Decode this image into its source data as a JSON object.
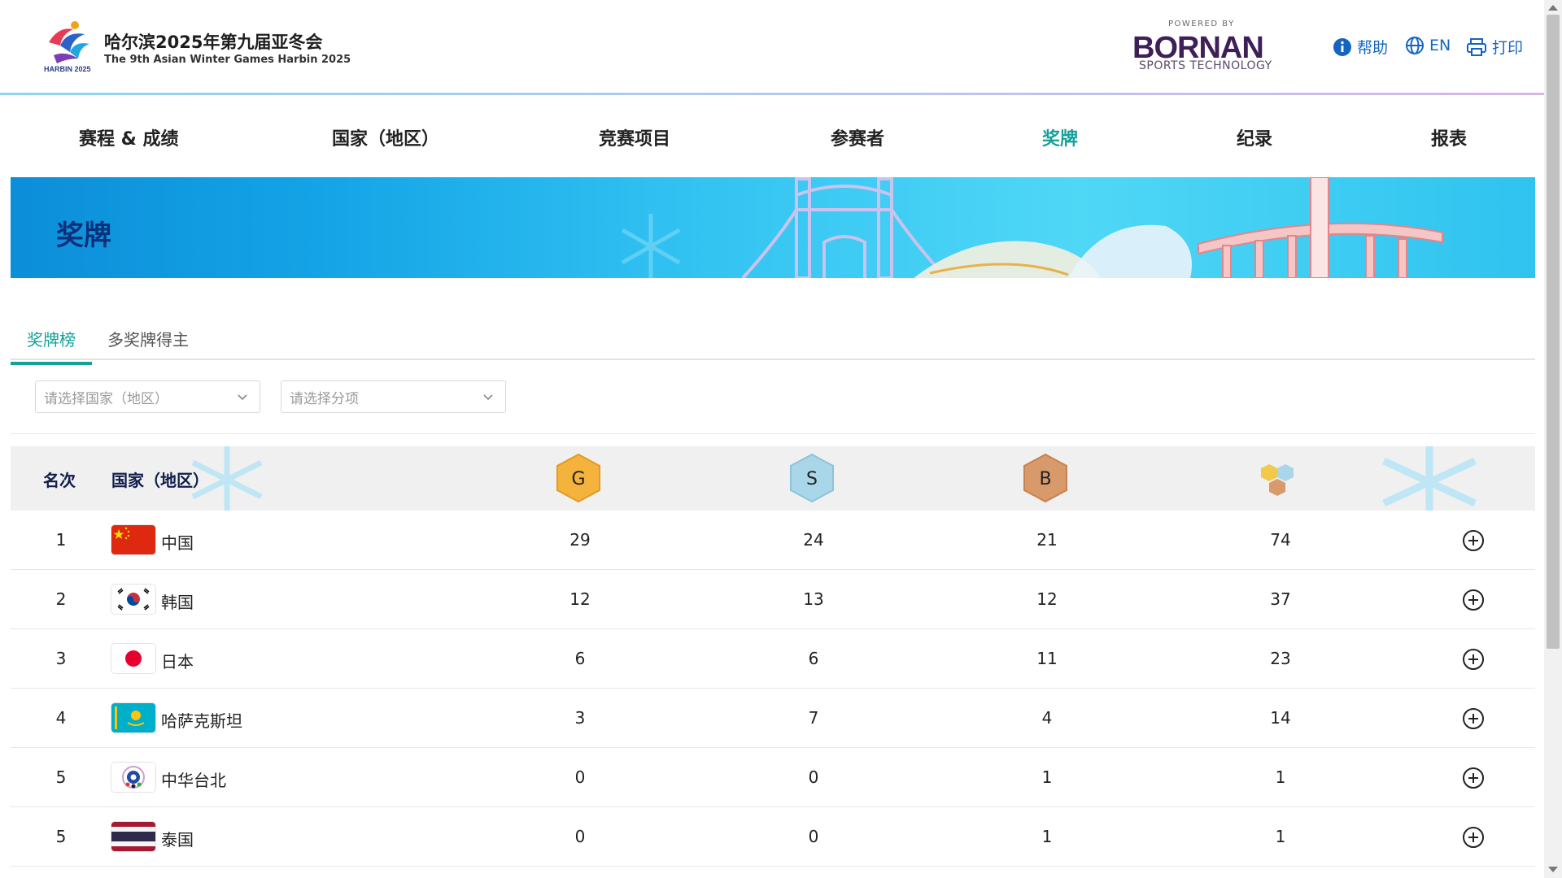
{
  "header": {
    "event_title": "哈尔滨2025年第九届亚冬会",
    "event_subtitle": "The 9th Asian Winter Games Harbin 2025",
    "logo_text": "HARBIN 2025",
    "powered_by": "POWERED BY",
    "sponsor_name": "BORNAN",
    "sponsor_sub": "SPORTS TECHNOLOGY",
    "help_label": "帮助",
    "lang_label": "EN",
    "print_label": "打印"
  },
  "nav": {
    "items": [
      {
        "label": "赛程 & 成绩"
      },
      {
        "label": "国家（地区）"
      },
      {
        "label": "竞赛项目"
      },
      {
        "label": "参赛者"
      },
      {
        "label": "奖牌"
      },
      {
        "label": "纪录"
      },
      {
        "label": "报表"
      }
    ],
    "active": "奖牌"
  },
  "banner": {
    "title": "奖牌"
  },
  "tabs": [
    {
      "label": "奖牌榜",
      "active": true
    },
    {
      "label": "多奖牌得主",
      "active": false
    }
  ],
  "filters": {
    "country_placeholder": "请选择国家（地区）",
    "discipline_placeholder": "请选择分项"
  },
  "table": {
    "headers": {
      "rank": "名次",
      "country": "国家（地区）",
      "gold": "G",
      "silver": "S",
      "bronze": "B"
    },
    "rows": [
      {
        "rank": "1",
        "country": "中国",
        "gold": "29",
        "silver": "24",
        "bronze": "21",
        "total": "74"
      },
      {
        "rank": "2",
        "country": "韩国",
        "gold": "12",
        "silver": "13",
        "bronze": "12",
        "total": "37"
      },
      {
        "rank": "3",
        "country": "日本",
        "gold": "6",
        "silver": "6",
        "bronze": "11",
        "total": "23"
      },
      {
        "rank": "4",
        "country": "哈萨克斯坦",
        "gold": "3",
        "silver": "7",
        "bronze": "4",
        "total": "14"
      },
      {
        "rank": "5",
        "country": "中华台北",
        "gold": "0",
        "silver": "0",
        "bronze": "1",
        "total": "1"
      },
      {
        "rank": "5",
        "country": "泰国",
        "gold": "0",
        "silver": "0",
        "bronze": "1",
        "total": "1"
      }
    ]
  },
  "colors": {
    "accent": "#13a19a",
    "header_text": "#111d4a",
    "gold": "#f3b33d",
    "silver": "#a9d6e8",
    "bronze": "#d89a6a"
  }
}
